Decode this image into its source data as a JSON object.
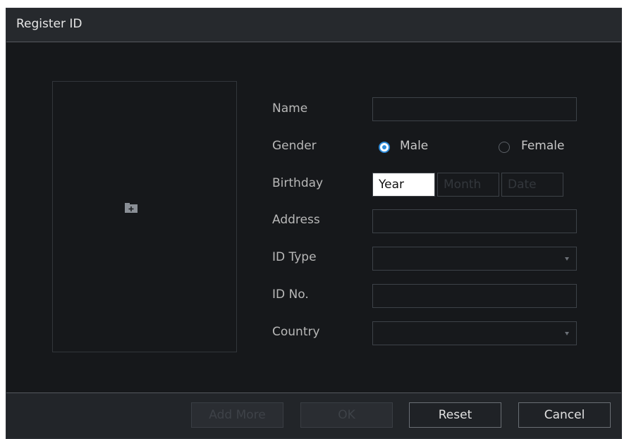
{
  "dialog": {
    "title": "Register ID"
  },
  "form": {
    "name_label": "Name",
    "name_value": "",
    "gender_label": "Gender",
    "gender_options": [
      "Male",
      "Female"
    ],
    "gender_selected": "Male",
    "birthday_label": "Birthday",
    "birthday_year": "Year",
    "birthday_month": "Month",
    "birthday_day": "Date",
    "address_label": "Address",
    "address_value": "",
    "id_type_label": "ID Type",
    "id_type_value": "",
    "id_no_label": "ID No.",
    "id_no_value": "",
    "country_label": "Country",
    "country_value": ""
  },
  "footer": {
    "add_more_label": "Add More",
    "ok_label": "OK",
    "reset_label": "Reset",
    "cancel_label": "Cancel"
  },
  "colors": {
    "accent": "#2e8bd8",
    "background": "#16181b",
    "title_bar": "#26292d"
  }
}
